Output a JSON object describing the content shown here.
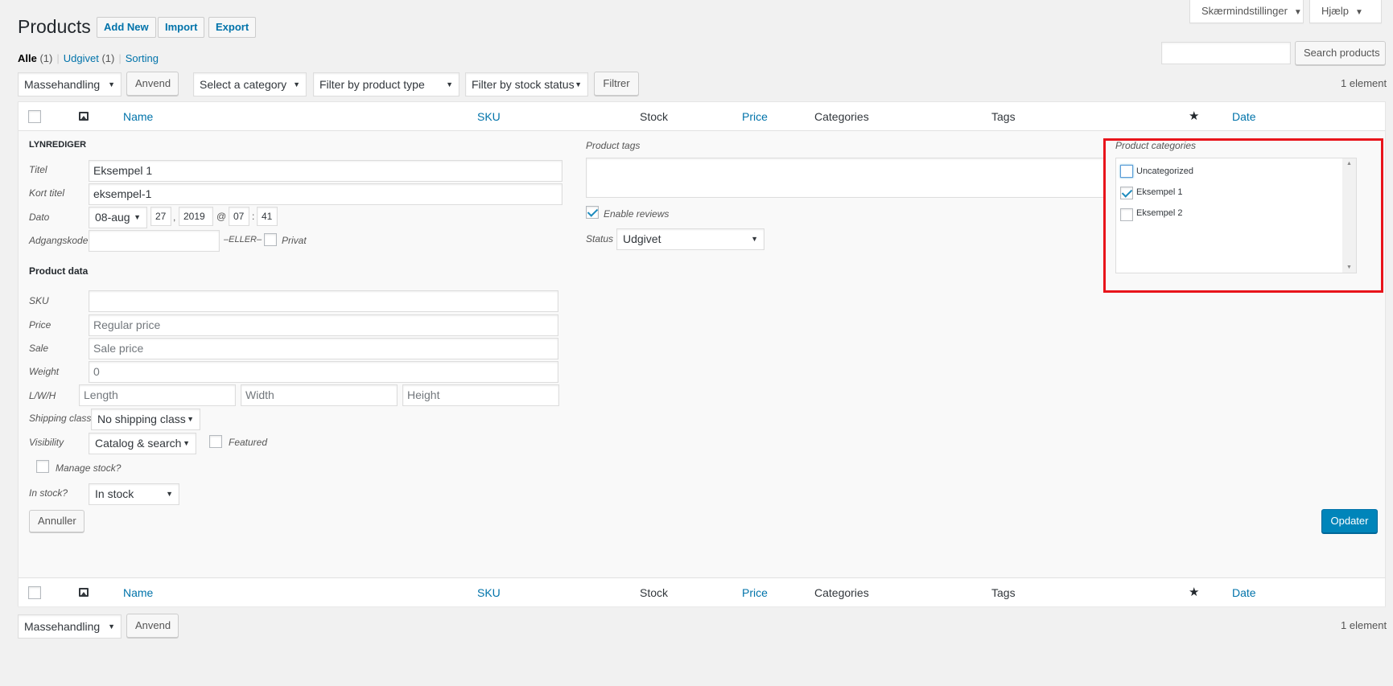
{
  "screen_options": {
    "screen_label": "Skærmindstillinger",
    "help_label": "Hjælp"
  },
  "header": {
    "title": "Products",
    "actions": {
      "add_new": "Add New",
      "import": "Import",
      "export": "Export"
    }
  },
  "views": {
    "all": "Alle",
    "all_count": "(1)",
    "published": "Udgivet",
    "published_count": "(1)",
    "sorting": "Sorting",
    "sep": "|"
  },
  "search": {
    "value": "",
    "button": "Search products"
  },
  "filters": {
    "bulk_action": "Massehandling",
    "apply": "Anvend",
    "category": "Select a category",
    "product_type": "Filter by product type",
    "stock_status": "Filter by stock status",
    "filter_button": "Filtrer",
    "count": "1 element"
  },
  "table": {
    "columns": {
      "name": "Name",
      "sku": "SKU",
      "stock": "Stock",
      "price": "Price",
      "categories": "Categories",
      "tags": "Tags",
      "date": "Date"
    }
  },
  "quickedit": {
    "legend": "LYNREDIGER",
    "title_label": "Titel",
    "title_value": "Eksempel 1",
    "slug_label": "Kort titel",
    "slug_value": "eksempel-1",
    "date_label": "Dato",
    "date_month": "08-aug",
    "date_day": "27",
    "date_comma": ",",
    "date_year": "2019",
    "date_at": "@",
    "date_hour": "07",
    "date_colon": ":",
    "date_min": "41",
    "password_label": "Adgangskode",
    "password_value": "",
    "or_label": "–ELLER–",
    "private_label": "Privat",
    "product_data": "Product data",
    "sku_label": "SKU",
    "sku_value": "",
    "price_label": "Price",
    "price_placeholder": "Regular price",
    "sale_label": "Sale",
    "sale_placeholder": "Sale price",
    "weight_label": "Weight",
    "weight_placeholder": "0",
    "lwh_label": "L/W/H",
    "length_placeholder": "Length",
    "width_placeholder": "Width",
    "height_placeholder": "Height",
    "shipping_label": "Shipping class",
    "shipping_value": "No shipping class",
    "visibility_label": "Visibility",
    "visibility_value": "Catalog & search",
    "featured_label": "Featured",
    "manage_stock_label": "Manage stock?",
    "in_stock_label": "In stock?",
    "in_stock_value": "In stock",
    "tags_label": "Product tags",
    "reviews_label": "Enable reviews",
    "status_label": "Status",
    "status_value": "Udgivet",
    "categories_label": "Product categories",
    "categories": [
      {
        "label": "Uncategorized",
        "checked": false
      },
      {
        "label": "Eksempel 1",
        "checked": true
      },
      {
        "label": "Eksempel 2",
        "checked": false
      }
    ],
    "cancel": "Annuller",
    "update": "Opdater"
  },
  "highlight_color": "#e8141b"
}
